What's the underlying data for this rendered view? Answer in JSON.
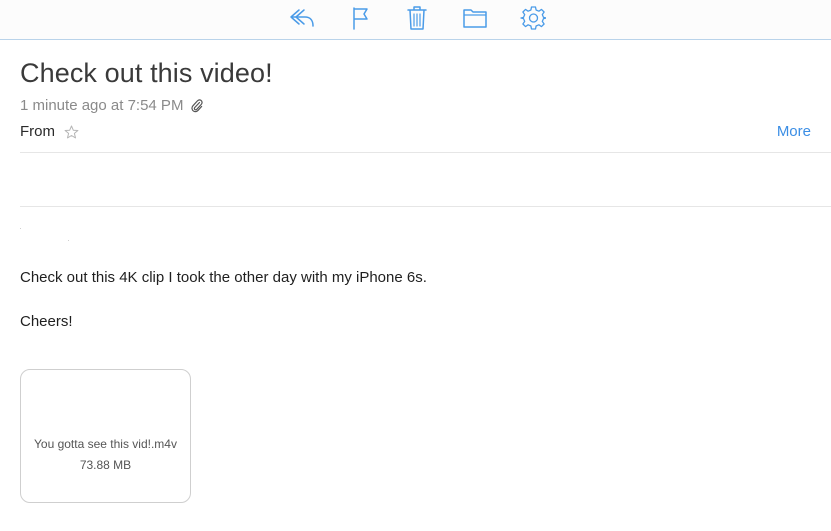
{
  "colors": {
    "accent": "#3b8ee5",
    "toolbar_icon": "#4a9be8",
    "toolbar_border": "#b9d3ea",
    "divider": "#e6e6e6"
  },
  "toolbar": {
    "icons": [
      "reply-icon",
      "flag-icon",
      "trash-icon",
      "folder-icon",
      "gear-icon"
    ]
  },
  "message": {
    "subject": "Check out this video!",
    "timestamp": "1 minute ago at 7:54 PM",
    "from_label": "From",
    "more_label": "More",
    "body_lines": [
      "Check out this 4K clip I took the other day with my iPhone 6s.",
      "Cheers!"
    ]
  },
  "attachment": {
    "filename": "You gotta see this vid!.m4v",
    "size": "73.88 MB"
  }
}
